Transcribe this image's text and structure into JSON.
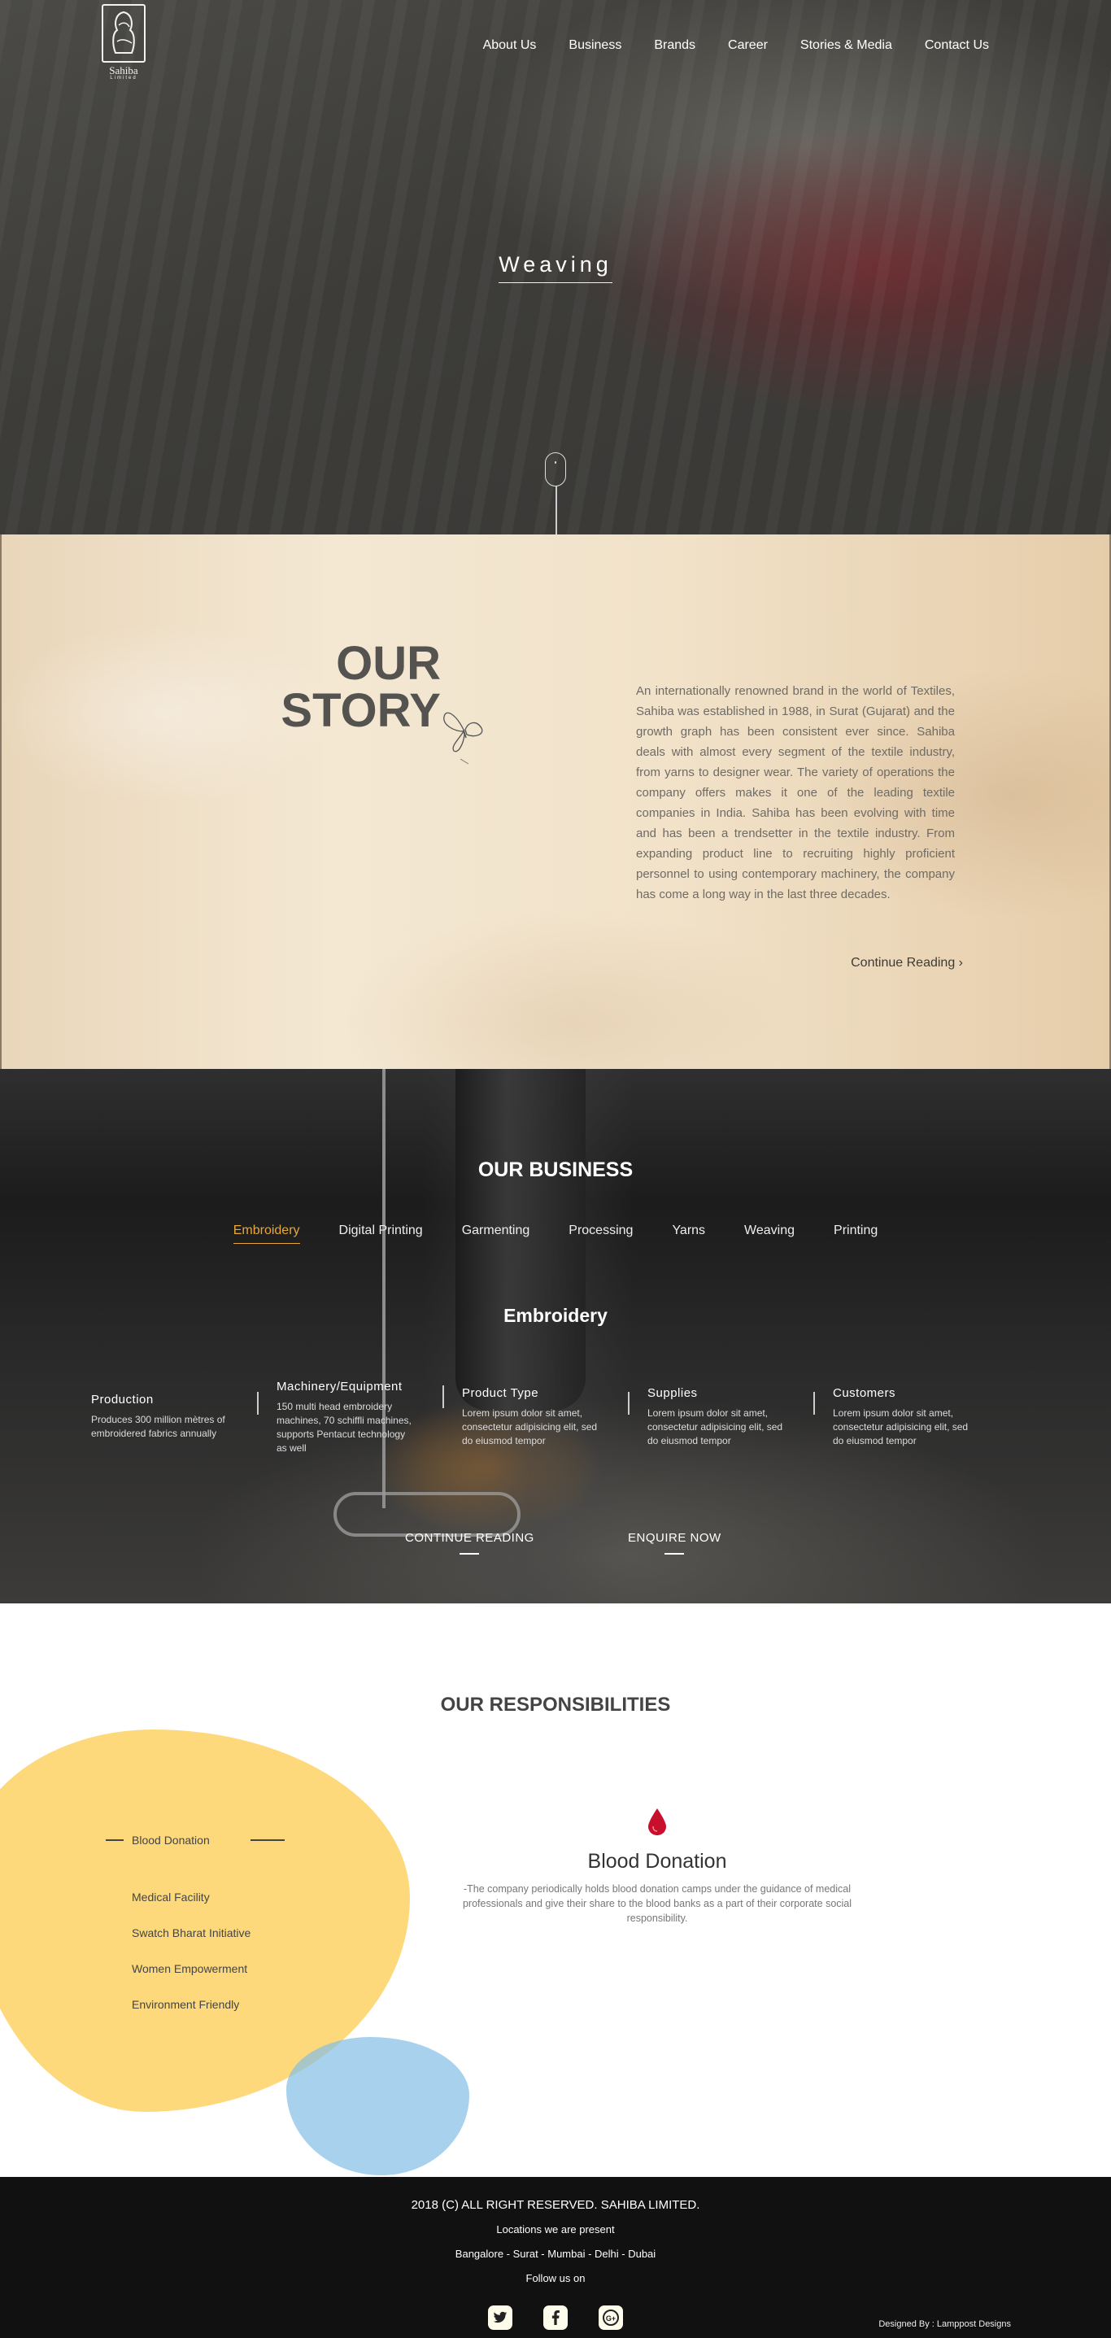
{
  "brand": {
    "name": "Sahiba",
    "tagline": "Limited"
  },
  "nav": [
    "About Us",
    "Business",
    "Brands",
    "Career",
    "Stories & Media",
    "Contact Us"
  ],
  "hero": {
    "title": "Weaving"
  },
  "story": {
    "heading_line1": "OUR",
    "heading_line2": "STORY",
    "body": "An internationally renowned brand in the world of Textiles, Sahiba was established in 1988, in Surat (Gujarat) and the growth graph has been consistent ever since. Sahiba deals with almost every segment of the textile industry, from yarns to designer wear. The variety of operations the company offers makes it one of the leading textile companies in India. Sahiba has been evolving with time and has been a trendsetter in the textile industry. From expanding product line to recruiting highly proficient personnel to using contemporary machinery, the company has come a long way in the last three decades.",
    "continue": "Continue Reading",
    "continue_glyph": "›"
  },
  "business": {
    "title": "OUR BUSINESS",
    "tabs": [
      "Embroidery",
      "Digital Printing",
      "Garmenting",
      "Processing",
      "Yarns",
      "Weaving",
      "Printing"
    ],
    "active_tab": "Embroidery",
    "subtitle": "Embroidery",
    "columns": [
      {
        "title": "Production",
        "text": "Produces 300 million mètres of embroidered fabrics annually"
      },
      {
        "title": "Machinery/Equipment",
        "text": "150 multi head embroidery machines, 70 schiffli machines, supports Pentacut technology as well"
      },
      {
        "title": "Product Type",
        "text": "Lorem ipsum dolor sit amet, consectetur adipisicing elit, sed do eiusmod tempor"
      },
      {
        "title": "Supplies",
        "text": "Lorem ipsum dolor sit amet, consectetur adipisicing elit, sed do eiusmod tempor"
      },
      {
        "title": "Customers",
        "text": "Lorem ipsum dolor sit amet, consectetur adipisicing elit, sed do eiusmod tempor"
      }
    ],
    "continue": "CONTINUE READING",
    "enquire": "ENQUIRE NOW"
  },
  "responsibilities": {
    "title": "OUR RESPONSIBILITIES",
    "active": "Blood Donation",
    "items": [
      "Medical Facility",
      "Swatch Bharat Initiative",
      "Women Empowerment",
      "Environment Friendly"
    ],
    "detail_title": "Blood Donation",
    "detail_text": "-The company periodically holds blood donation camps under the guidance of medical professionals and give their share to the blood banks as a part of their corporate social responsibility.",
    "accent": "#fdd97b",
    "accent2": "#82bee6"
  },
  "footer": {
    "copyright": "2018 (C) ALL RIGHT RESERVED. SAHIBA LIMITED.",
    "locations_label": "Locations we are present",
    "locations": "Bangalore - Surat - Mumbai - Delhi - Dubai",
    "follow": "Follow us on",
    "social": [
      "twitter-icon",
      "facebook-icon",
      "google-plus-icon"
    ],
    "designed_by": "Designed By : Lamppost Designs"
  }
}
